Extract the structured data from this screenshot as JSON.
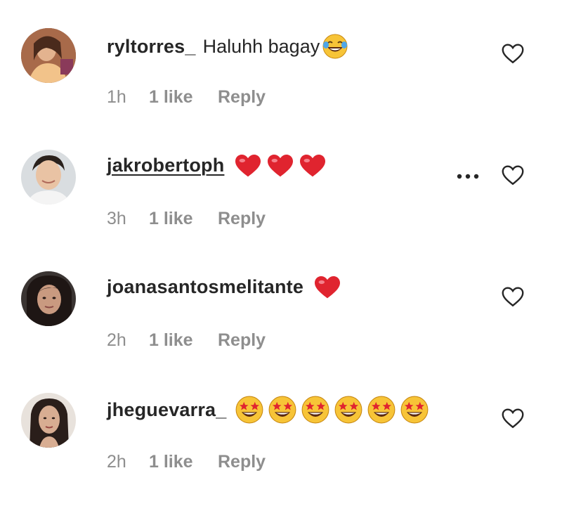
{
  "comments": [
    {
      "username": "ryltorres_",
      "text": "Haluhh bagay",
      "emojis": [
        "face-with-tears-of-joy"
      ],
      "time": "1h",
      "likes": "1 like",
      "reply_label": "Reply",
      "has_more": false
    },
    {
      "username": "jakrobertoph",
      "text": "",
      "emojis": [
        "red-heart",
        "red-heart",
        "red-heart"
      ],
      "time": "3h",
      "likes": "1 like",
      "reply_label": "Reply",
      "has_more": true
    },
    {
      "username": "joanasantosmelitante",
      "text": "",
      "emojis": [
        "red-heart"
      ],
      "time": "2h",
      "likes": "1 like",
      "reply_label": "Reply",
      "has_more": false
    },
    {
      "username": "jheguevarra_",
      "text": "",
      "emojis": [
        "star-struck",
        "star-struck",
        "star-struck",
        "star-struck",
        "star-struck",
        "star-struck"
      ],
      "time": "2h",
      "likes": "1 like",
      "reply_label": "Reply",
      "has_more": false
    }
  ],
  "icons": {
    "like": "heart-outline-icon",
    "more": "more-options-icon"
  },
  "colors": {
    "muted_text": "#8e8e8e",
    "primary_text": "#262626",
    "heart_emoji": "#e0242f",
    "emoji_face": "#f7c437"
  }
}
